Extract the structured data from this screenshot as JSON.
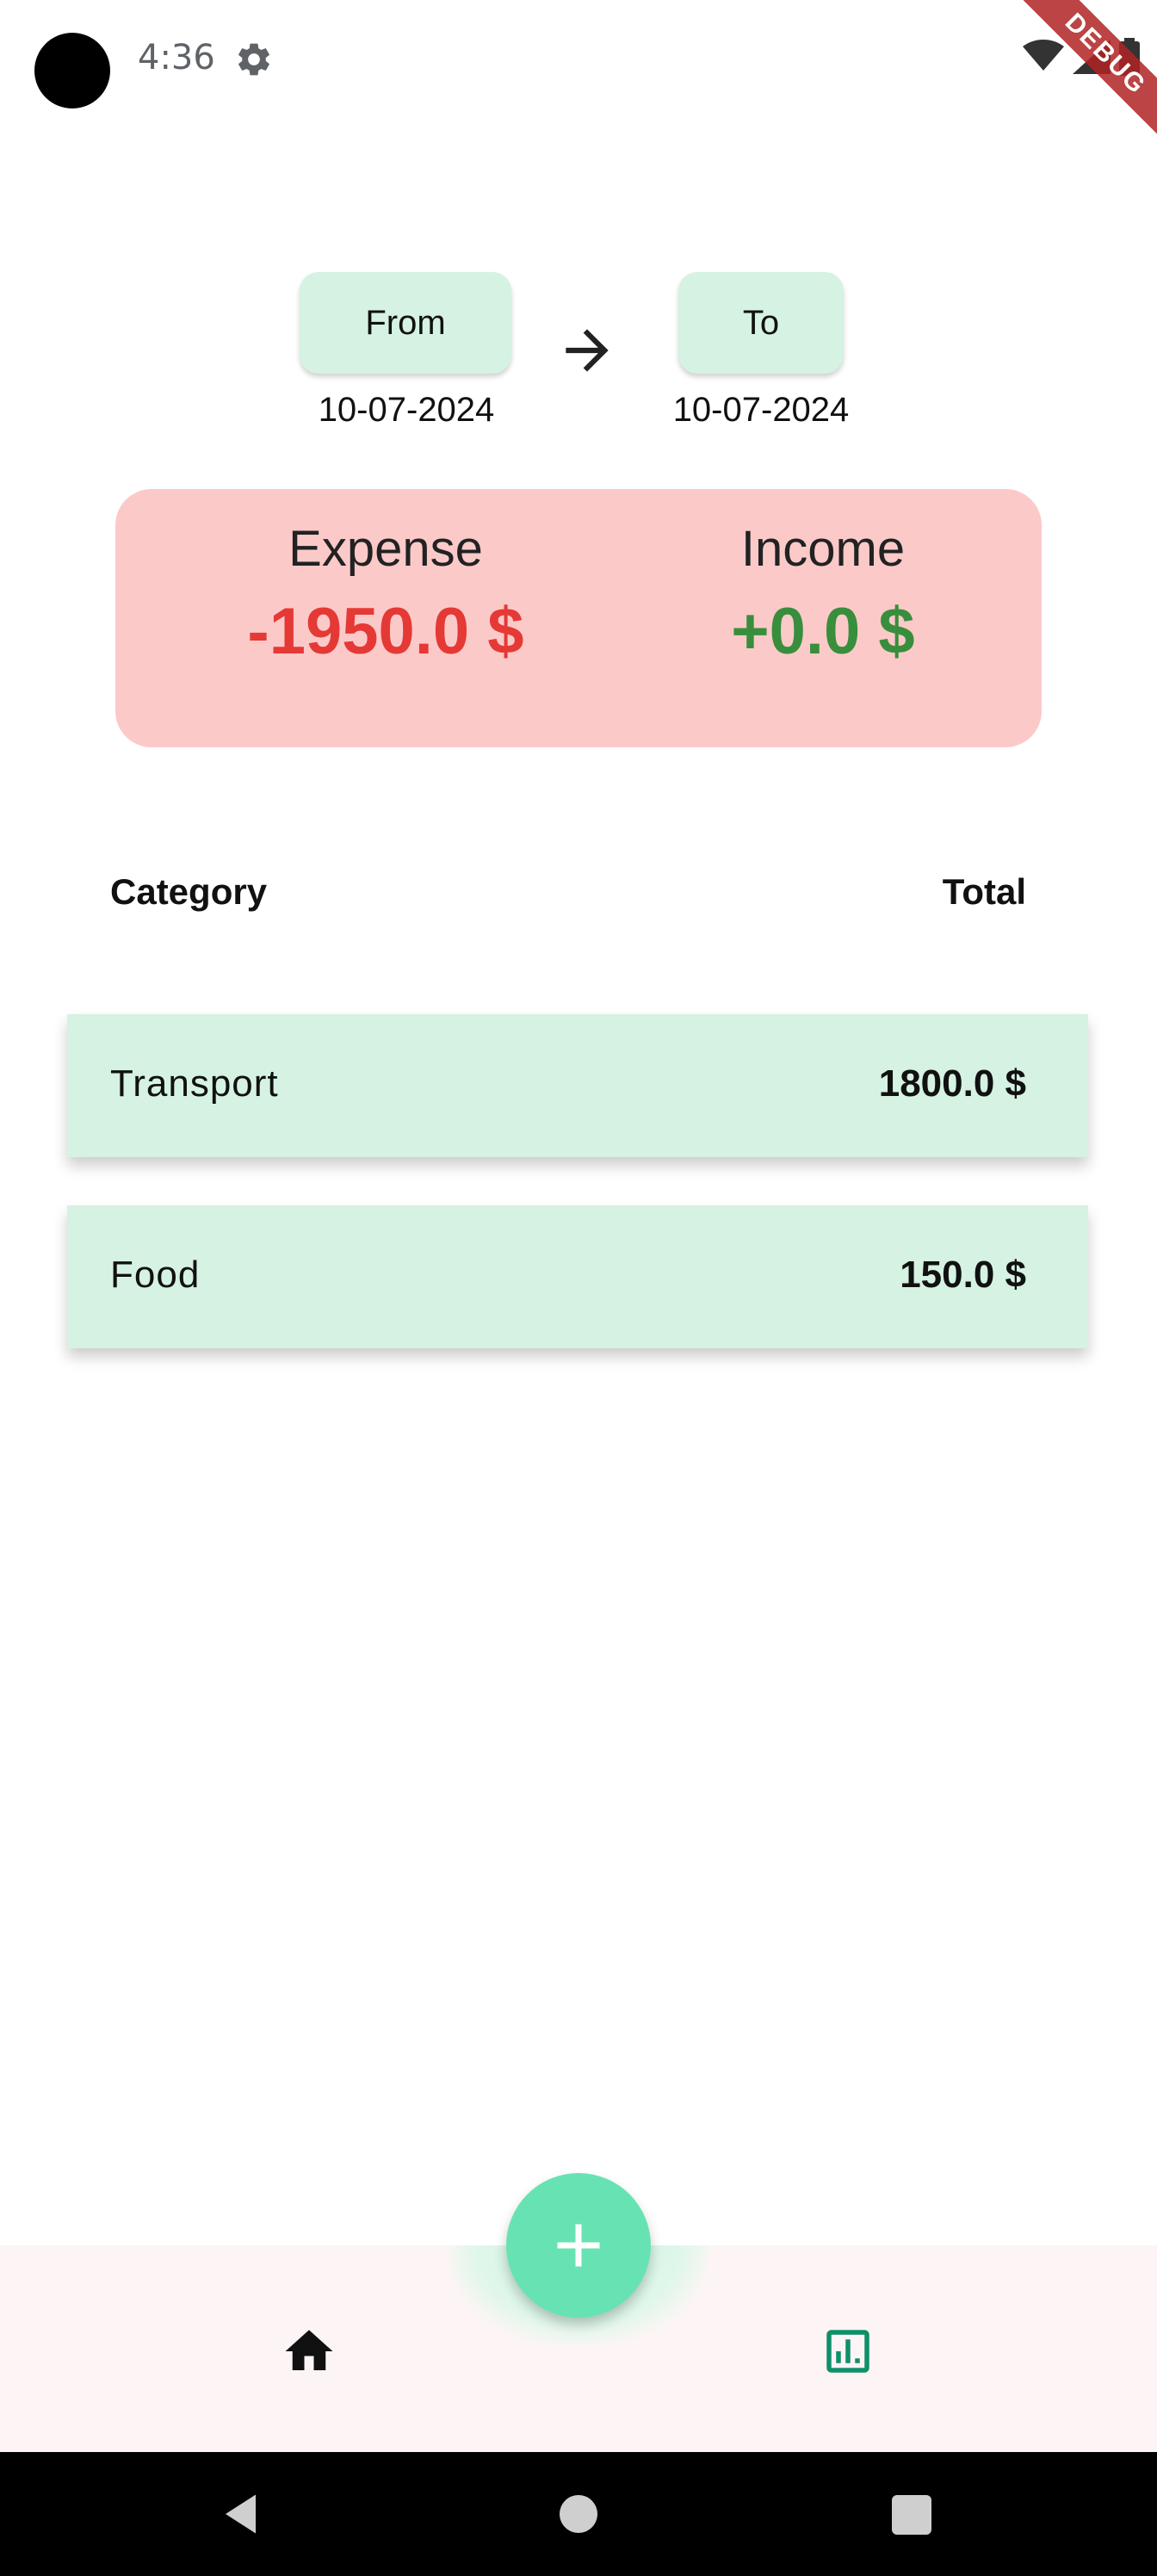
{
  "status_bar": {
    "time": "4:36",
    "icons": [
      "settings-icon",
      "wifi-icon",
      "signal-icon",
      "battery-icon"
    ]
  },
  "debug_banner": "DEBUG",
  "date_range": {
    "from_label": "From",
    "from_date": "10-07-2024",
    "to_label": "To",
    "to_date": "10-07-2024"
  },
  "summary": {
    "expense_title": "Expense",
    "expense_value": "-1950.0 $",
    "income_title": "Income",
    "income_value": "+0.0 $",
    "colors": {
      "card_bg": "#fcc9c9",
      "expense": "#e53935",
      "income": "#388e3c"
    }
  },
  "table": {
    "headers": {
      "category": "Category",
      "total": "Total"
    },
    "rows": [
      {
        "category": "Transport",
        "total": "1800.0 $"
      },
      {
        "category": "Food",
        "total": "150.0 $"
      }
    ]
  },
  "bottom_nav": {
    "items": [
      "home-icon",
      "add-icon",
      "bar-chart-icon"
    ],
    "accent": "#67e3b3"
  },
  "system_nav": [
    "back-icon",
    "home-circle-icon",
    "recents-square-icon"
  ]
}
